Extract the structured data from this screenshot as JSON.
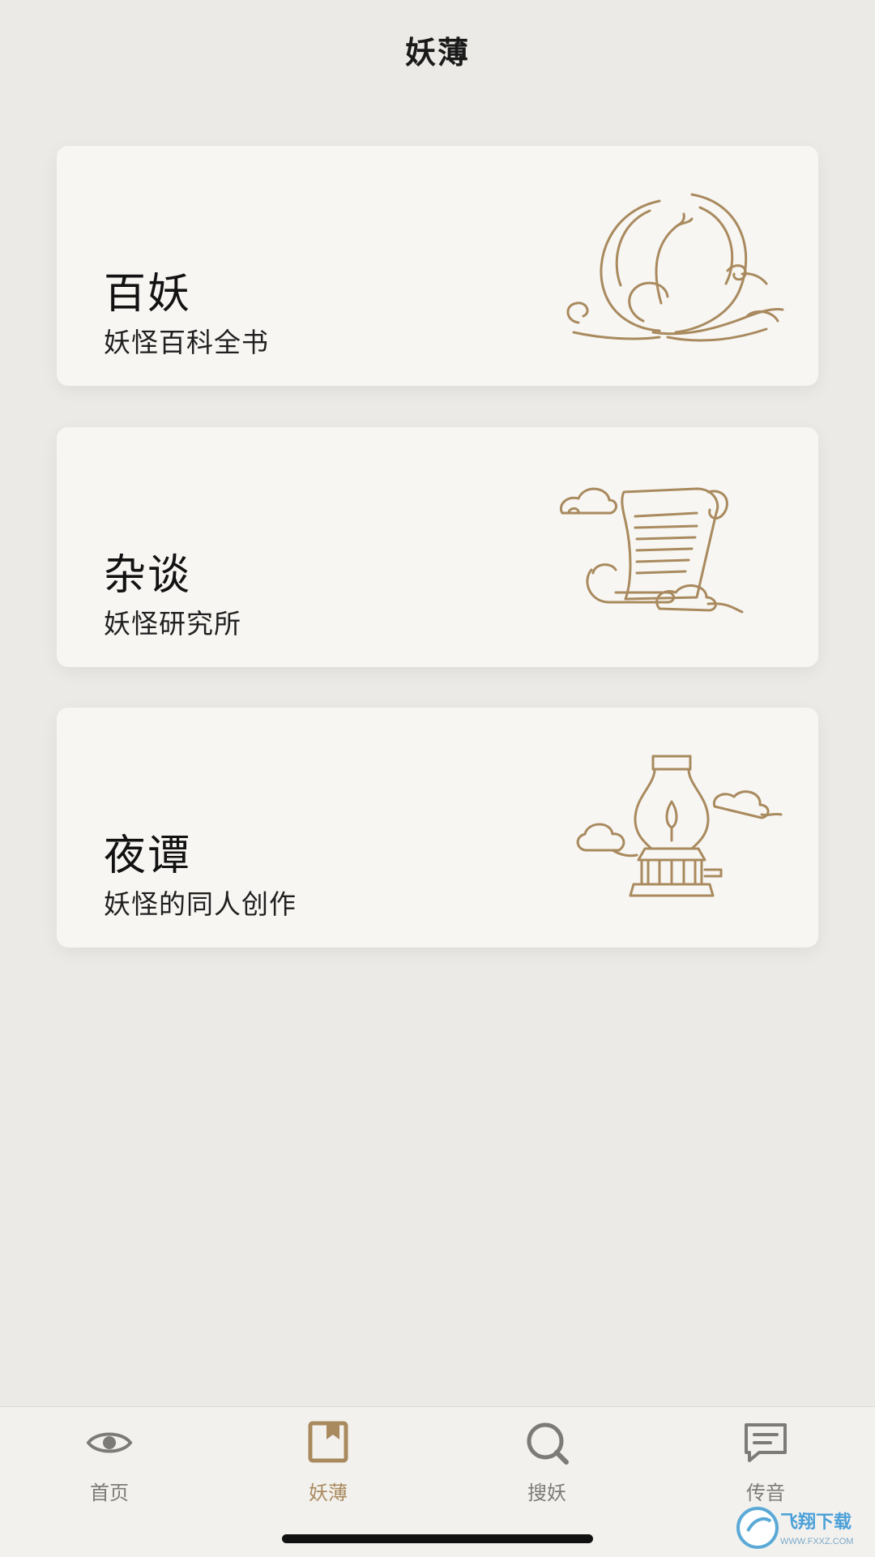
{
  "header": {
    "title": "妖薄"
  },
  "cards": [
    {
      "title": "百妖",
      "subtitle": "妖怪百科全书",
      "icon": "phoenix-icon"
    },
    {
      "title": "杂谈",
      "subtitle": "妖怪研究所",
      "icon": "scroll-icon"
    },
    {
      "title": "夜谭",
      "subtitle": "妖怪的同人创作",
      "icon": "lamp-icon"
    }
  ],
  "tabbar": {
    "tabs": [
      {
        "label": "首页",
        "icon": "eye-icon"
      },
      {
        "label": "妖薄",
        "icon": "bookmark-book-icon",
        "active": true
      },
      {
        "label": "搜妖",
        "icon": "search-icon"
      },
      {
        "label": "传音",
        "icon": "chat-icon"
      }
    ]
  },
  "watermark": {
    "text": "飞翔下载",
    "url": "WWW.FXXZ.COM"
  },
  "colors": {
    "background": "#eceae6",
    "card": "#f7f6f3",
    "gold": "#a98a5e",
    "tab_inactive": "#7d7b77"
  }
}
